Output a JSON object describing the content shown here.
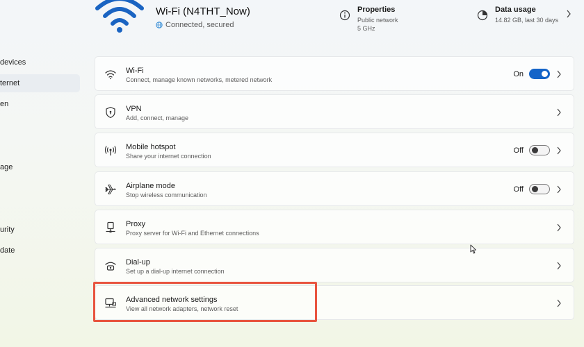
{
  "sidebar": {
    "items": [
      {
        "label": "devices"
      },
      {
        "label": "ternet"
      },
      {
        "label": "en"
      },
      {
        "label": "age"
      },
      {
        "label": "urity"
      },
      {
        "label": "date"
      }
    ]
  },
  "header": {
    "network_name": "Wi-Fi (N4THT_Now)",
    "status": "Connected, secured",
    "properties": {
      "title": "Properties",
      "line1": "Public network",
      "line2": "5 GHz"
    },
    "data_usage": {
      "title": "Data usage",
      "line1": "14.82 GB, last 30 days"
    }
  },
  "settings": [
    {
      "title": "Wi-Fi",
      "subtitle": "Connect, manage known networks, metered network",
      "toggle": "On",
      "icon": "wifi-icon"
    },
    {
      "title": "VPN",
      "subtitle": "Add, connect, manage",
      "icon": "shield-icon"
    },
    {
      "title": "Mobile hotspot",
      "subtitle": "Share your internet connection",
      "toggle": "Off",
      "icon": "hotspot-icon"
    },
    {
      "title": "Airplane mode",
      "subtitle": "Stop wireless communication",
      "toggle": "Off",
      "icon": "airplane-icon"
    },
    {
      "title": "Proxy",
      "subtitle": "Proxy server for Wi-Fi and Ethernet connections",
      "icon": "proxy-icon"
    },
    {
      "title": "Dial-up",
      "subtitle": "Set up a dial-up internet connection",
      "icon": "dialup-icon"
    },
    {
      "title": "Advanced network settings",
      "subtitle": "View all network adapters, network reset",
      "icon": "network-adapter-icon"
    }
  ],
  "colors": {
    "accent": "#1464c8",
    "highlight": "#e8543f"
  }
}
